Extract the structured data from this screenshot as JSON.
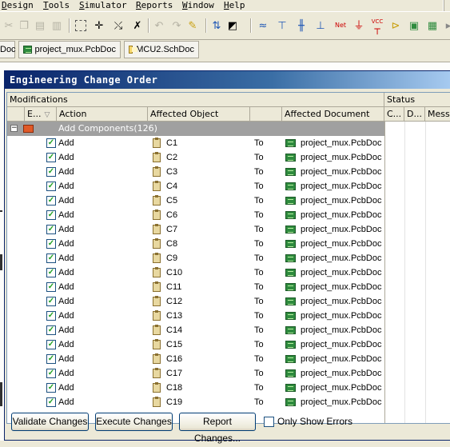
{
  "menubar": {
    "items": [
      {
        "label": "Design",
        "hotkey_index": 0
      },
      {
        "label": "Tools",
        "hotkey_index": 0
      },
      {
        "label": "Simulator",
        "hotkey_index": 0
      },
      {
        "label": "Reports",
        "hotkey_index": 0
      },
      {
        "label": "Window",
        "hotkey_index": 0
      },
      {
        "label": "Help",
        "hotkey_index": 0
      }
    ]
  },
  "toolbar": {
    "icons": [
      "cut-icon",
      "copy-icon",
      "paste-icon",
      "paste-special-icon",
      "select-area-icon",
      "move-icon",
      "cross-probe-icon",
      "clear-selection-icon",
      "undo-icon",
      "redo-icon",
      "edit-icon",
      "update-icon",
      "browse-icon",
      "wire-icon",
      "bus-icon",
      "bus-entry-icon",
      "net-label-icon",
      "net-icon",
      "ground-icon",
      "vcc-icon",
      "port-icon",
      "part-icon",
      "sheet-symbol-icon"
    ],
    "net_label_text": "Net",
    "vcc_label_text": "VCC"
  },
  "tabs": [
    {
      "label": "Doc",
      "icon": "pcb-doc-icon"
    },
    {
      "label": "project_mux.PcbDoc",
      "icon": "pcb-doc-icon"
    },
    {
      "label": "MCU2.SchDoc",
      "icon": "sch-doc-icon"
    }
  ],
  "dialog": {
    "title": "Engineering Change Order",
    "group_modifications": "Modifications",
    "group_status": "Status",
    "columns": {
      "enable": "E...",
      "action": "Action",
      "affected_object": "Affected Object",
      "affected_document": "Affected Document",
      "check": "C...",
      "done": "D...",
      "message": "Message"
    },
    "group_row": {
      "label": "Add Components(126)",
      "expander": "−"
    },
    "rows": [
      {
        "checked": "✓",
        "action": "Add",
        "object": "C1",
        "to": "To",
        "document": "project_mux.PcbDoc"
      },
      {
        "checked": "✓",
        "action": "Add",
        "object": "C2",
        "to": "To",
        "document": "project_mux.PcbDoc"
      },
      {
        "checked": "✓",
        "action": "Add",
        "object": "C3",
        "to": "To",
        "document": "project_mux.PcbDoc"
      },
      {
        "checked": "✓",
        "action": "Add",
        "object": "C4",
        "to": "To",
        "document": "project_mux.PcbDoc"
      },
      {
        "checked": "✓",
        "action": "Add",
        "object": "C5",
        "to": "To",
        "document": "project_mux.PcbDoc"
      },
      {
        "checked": "✓",
        "action": "Add",
        "object": "C6",
        "to": "To",
        "document": "project_mux.PcbDoc"
      },
      {
        "checked": "✓",
        "action": "Add",
        "object": "C7",
        "to": "To",
        "document": "project_mux.PcbDoc"
      },
      {
        "checked": "✓",
        "action": "Add",
        "object": "C8",
        "to": "To",
        "document": "project_mux.PcbDoc"
      },
      {
        "checked": "✓",
        "action": "Add",
        "object": "C9",
        "to": "To",
        "document": "project_mux.PcbDoc"
      },
      {
        "checked": "✓",
        "action": "Add",
        "object": "C10",
        "to": "To",
        "document": "project_mux.PcbDoc"
      },
      {
        "checked": "✓",
        "action": "Add",
        "object": "C11",
        "to": "To",
        "document": "project_mux.PcbDoc"
      },
      {
        "checked": "✓",
        "action": "Add",
        "object": "C12",
        "to": "To",
        "document": "project_mux.PcbDoc"
      },
      {
        "checked": "✓",
        "action": "Add",
        "object": "C13",
        "to": "To",
        "document": "project_mux.PcbDoc"
      },
      {
        "checked": "✓",
        "action": "Add",
        "object": "C14",
        "to": "To",
        "document": "project_mux.PcbDoc"
      },
      {
        "checked": "✓",
        "action": "Add",
        "object": "C15",
        "to": "To",
        "document": "project_mux.PcbDoc"
      },
      {
        "checked": "✓",
        "action": "Add",
        "object": "C16",
        "to": "To",
        "document": "project_mux.PcbDoc"
      },
      {
        "checked": "✓",
        "action": "Add",
        "object": "C17",
        "to": "To",
        "document": "project_mux.PcbDoc"
      },
      {
        "checked": "✓",
        "action": "Add",
        "object": "C18",
        "to": "To",
        "document": "project_mux.PcbDoc"
      },
      {
        "checked": "✓",
        "action": "Add",
        "object": "C19",
        "to": "To",
        "document": "project_mux.PcbDoc"
      }
    ],
    "buttons": {
      "validate": "Validate Changes",
      "execute": "Execute Changes",
      "report": "Report Changes...",
      "only_show_errors": "Only Show Errors"
    }
  },
  "colors": {
    "title_start": "#0a246a",
    "title_end": "#a6caf0",
    "group_row": "#a0a0a0",
    "check": "#21a121"
  }
}
